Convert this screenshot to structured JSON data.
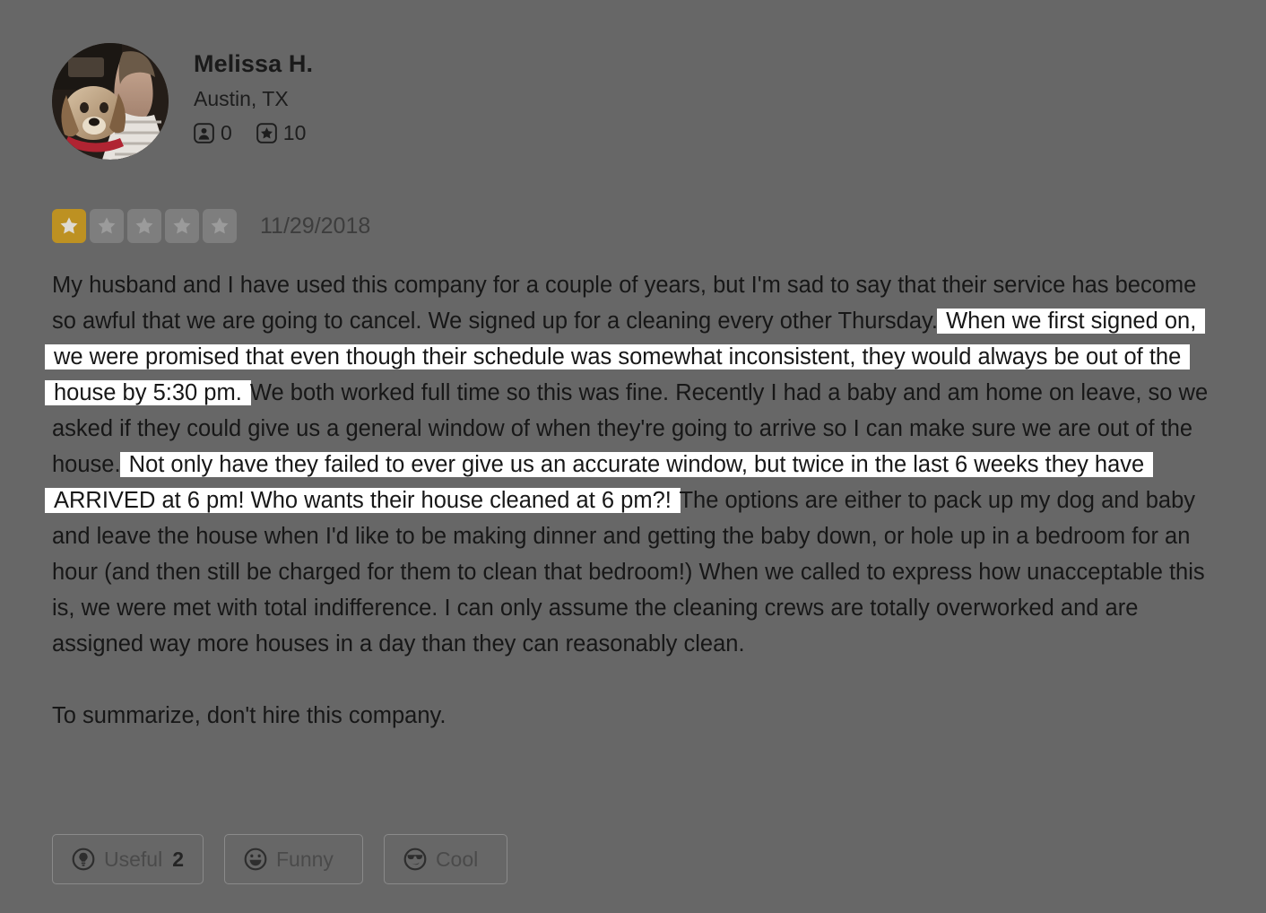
{
  "theme": {
    "page_bg": "#676767",
    "highlight_bg": "#ffffff",
    "star_active": "#bd9122",
    "star_inactive": "#7e7e7e",
    "text": "#171717"
  },
  "reviewer": {
    "avatar_alt": "avatar-photo-woman-with-dog",
    "name": "Melissa H.",
    "location": "Austin, TX",
    "stats": [
      {
        "icon": "friends-icon",
        "value": "0"
      },
      {
        "icon": "reviews-star-icon",
        "value": "10"
      }
    ]
  },
  "rating": {
    "value": 1,
    "max": 5,
    "date": "11/29/2018"
  },
  "review": {
    "paragraph1": {
      "seg1": "My husband and I have used this company for a couple of years, but I'm sad to say that their service has become so awful that we are going to cancel. We signed up for a cleaning every other Thursday. ",
      "hl1": "When we first signed on, we were promised that even though their schedule was somewhat inconsistent, they would always be out of the house by 5:30 pm.",
      "seg2": " We both worked full time so this was fine. Recently I had a baby and am home on leave, so we asked if they could give us a general window of when they're going to arrive so I can make sure we are out of the house. ",
      "hl2": "Not only have they failed to ever give us an accurate window, but twice in the last 6 weeks they have ARRIVED at 6 pm! Who wants their house cleaned at 6 pm?!",
      "seg3": " The options are either to pack up my dog and baby and leave the house when I'd like to be making dinner and getting the baby down, or hole up in a bedroom for an hour (and then still be charged for them to clean that bedroom!) When we called to express how unacceptable this is, we were met with total indifference. I can only assume the cleaning crews are totally overworked and are assigned way more houses in a day than they can reasonably clean."
    },
    "paragraph2": "To summarize, don't hire this company."
  },
  "actions": [
    {
      "icon": "useful-lightbulb-icon",
      "label": "Useful",
      "count": "2"
    },
    {
      "icon": "funny-laugh-icon",
      "label": "Funny",
      "count": ""
    },
    {
      "icon": "cool-sunglasses-icon",
      "label": "Cool",
      "count": ""
    }
  ]
}
